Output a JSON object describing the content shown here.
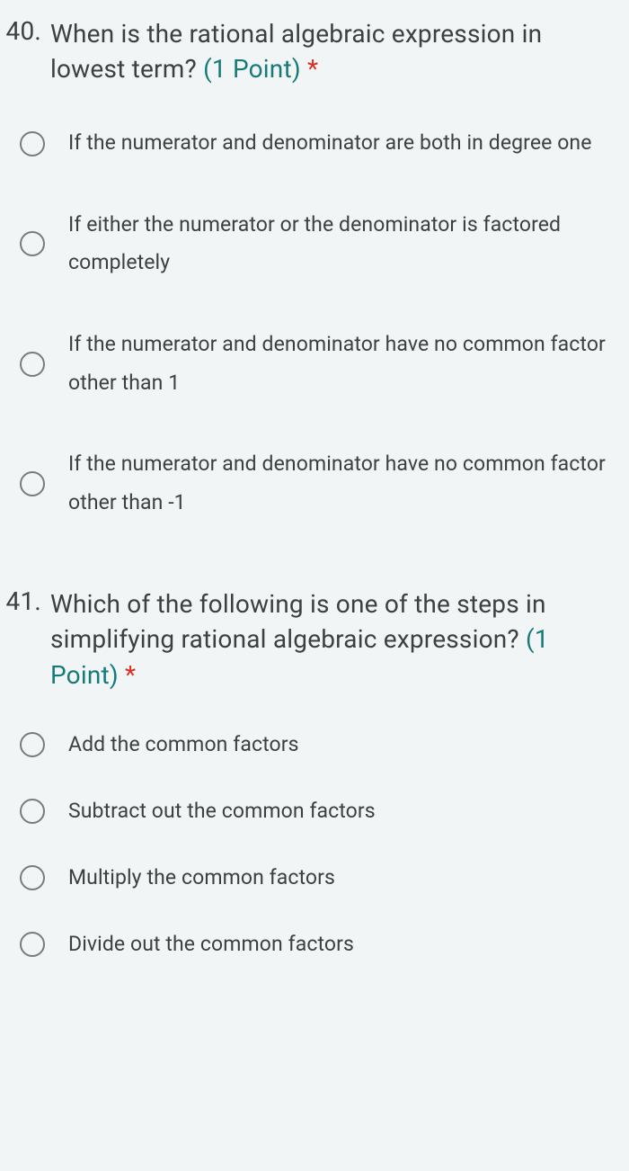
{
  "questions": [
    {
      "number": "40.",
      "text": "When is the rational algebraic expression in lowest term?",
      "points": "(1 Point)",
      "required": "*",
      "options": [
        "If the numerator and denominator are both in degree one",
        "If either the numerator or the denominator is factored completely",
        "If the numerator and denominator have no common factor other than 1",
        "If the numerator and denominator have no common factor other than -1"
      ]
    },
    {
      "number": "41.",
      "text": "Which of the following is one of the steps in simplifying rational algebraic expression?",
      "points": "(1 Point)",
      "required": "*",
      "options": [
        "Add the common factors",
        "Subtract out the common factors",
        "Multiply the common factors",
        "Divide out the common factors"
      ]
    }
  ]
}
